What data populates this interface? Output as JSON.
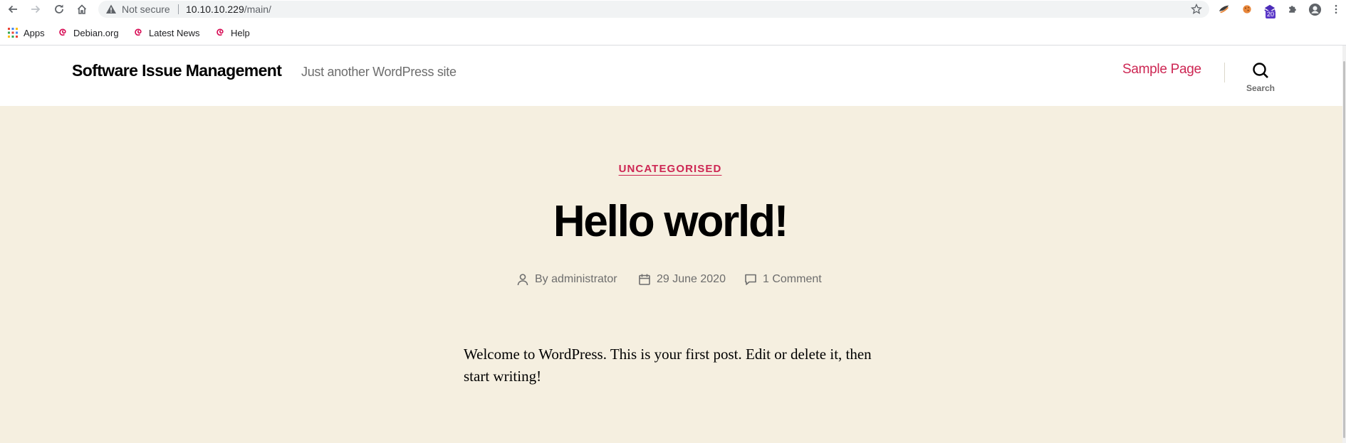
{
  "browser": {
    "security_label": "Not secure",
    "url_host": "10.10.10.229",
    "url_path": "/main/",
    "extension_badge": "20",
    "bookmarks": [
      {
        "label": "Apps"
      },
      {
        "label": "Debian.org"
      },
      {
        "label": "Latest News"
      },
      {
        "label": "Help"
      }
    ]
  },
  "site": {
    "title": "Software Issue Management",
    "tagline": "Just another WordPress site",
    "menu": [
      {
        "label": "Sample Page"
      }
    ],
    "search_label": "Search"
  },
  "post": {
    "category": "UNCATEGORISED",
    "title": "Hello world!",
    "author_prefix": "By",
    "author": "administrator",
    "date": "29 June 2020",
    "comments": "1 Comment",
    "content": "Welcome to WordPress. This is your first post. Edit or delete it, then start writing!"
  },
  "colors": {
    "accent": "#cd2653",
    "post_background": "#f5efe0",
    "secondary_text": "#6d6d6d"
  }
}
